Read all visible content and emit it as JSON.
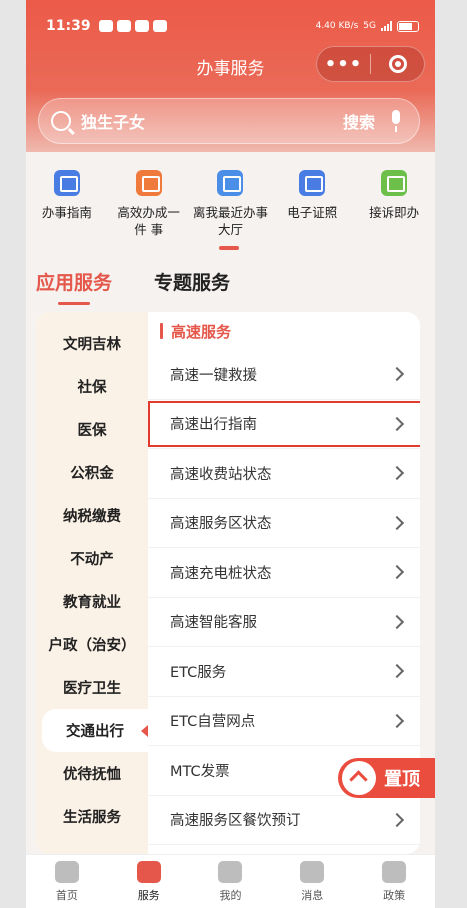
{
  "status_bar": {
    "time": "11:39",
    "speed": "4.40 KB/s",
    "network": "5G"
  },
  "header": {
    "title": "办事服务",
    "capsule_more": "•••"
  },
  "search": {
    "query": "独生子女",
    "button": "搜索"
  },
  "tiles": [
    {
      "label": "办事指南",
      "color": "#4a7de3",
      "icon": "guide-icon"
    },
    {
      "label": "高效办成一 件 事",
      "color": "#f07a3c",
      "icon": "efficient-icon"
    },
    {
      "label": "离我最近办事大厅",
      "color": "#4a8ee8",
      "icon": "location-icon"
    },
    {
      "label": "电子证照",
      "color": "#4a7de3",
      "icon": "id-card-icon"
    },
    {
      "label": "接诉即办",
      "color": "#6cc04a",
      "icon": "complaint-icon"
    }
  ],
  "tabs": [
    {
      "label": "应用服务",
      "active": true
    },
    {
      "label": "专题服务",
      "active": false
    }
  ],
  "categories": [
    "文明吉林",
    "社保",
    "医保",
    "公积金",
    "纳税缴费",
    "不动产",
    "教育就业",
    "户政（治安）",
    "医疗卫生",
    "交通出行",
    "优待抚恤",
    "生活服务"
  ],
  "active_category": "交通出行",
  "section": {
    "title": "高速服务",
    "items": [
      "高速一键救援",
      "高速出行指南",
      "高速收费站状态",
      "高速服务区状态",
      "高速充电桩状态",
      "高速智能客服",
      "ETC服务",
      "ETC自营网点",
      "MTC发票",
      "高速服务区餐饮预订"
    ],
    "highlighted": "高速出行指南"
  },
  "pin_top": {
    "label": "置顶"
  },
  "nav": [
    {
      "label": "首页",
      "icon": "home-icon",
      "active": false
    },
    {
      "label": "服务",
      "icon": "service-icon",
      "active": true
    },
    {
      "label": "我的",
      "icon": "user-icon",
      "active": false
    },
    {
      "label": "消息",
      "icon": "bell-icon",
      "active": false
    },
    {
      "label": "政策",
      "icon": "policy-icon",
      "active": false
    }
  ],
  "colors": {
    "accent": "#e4574a",
    "highlight_border": "#e23a2e",
    "category_bg": "#fbf2e7"
  }
}
